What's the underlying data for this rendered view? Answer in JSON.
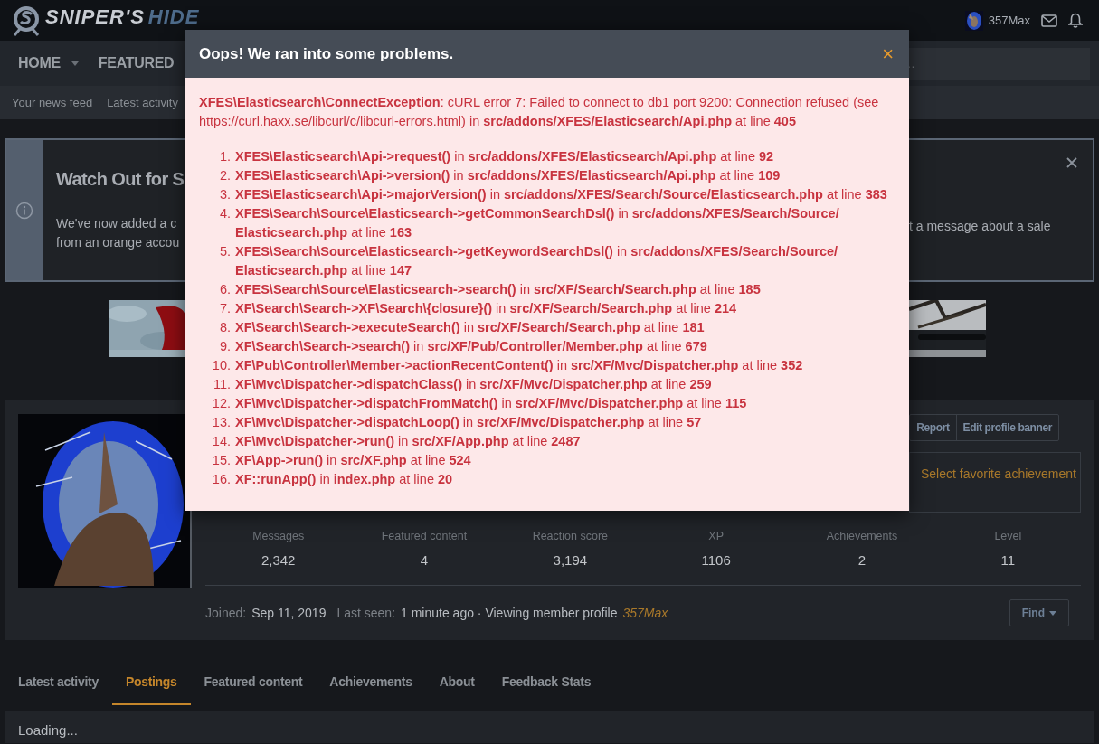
{
  "header": {
    "logo_primary": "SNIPER'S",
    "logo_secondary": "HIDE",
    "username": "357Max"
  },
  "nav": {
    "items": [
      {
        "label": "HOME",
        "dropdown": true
      },
      {
        "label": "FEATURED",
        "dropdown": false
      }
    ],
    "search": {
      "placeholder": "…"
    }
  },
  "subnav": [
    "Your news feed",
    "Latest activity"
  ],
  "notice": {
    "title": "Watch Out for S",
    "text_left": [
      "We've now added a c",
      "from an orange accou"
    ],
    "text_right": "t a message about a sale"
  },
  "profile": {
    "buttons": [
      "Report",
      "Edit profile banner"
    ],
    "favorite_achievement": "Select favorite achievement",
    "stats": [
      {
        "label": "Messages",
        "value": "2,342"
      },
      {
        "label": "Featured content",
        "value": "4"
      },
      {
        "label": "Reaction score",
        "value": "3,194"
      },
      {
        "label": "XP",
        "value": "1106"
      },
      {
        "label": "Achievements",
        "value": "2"
      },
      {
        "label": "Level",
        "value": "11"
      }
    ],
    "joined_label": "Joined:",
    "joined": "Sep 11, 2019",
    "last_seen_label": "Last seen:",
    "last_seen": "1 minute ago · Viewing member profile",
    "last_seen_name": "357Max",
    "find_button": "Find"
  },
  "tabs": [
    {
      "label": "Latest activity",
      "selected": false
    },
    {
      "label": "Postings",
      "selected": true
    },
    {
      "label": "Featured content",
      "selected": false
    },
    {
      "label": "Achievements",
      "selected": false
    },
    {
      "label": "About",
      "selected": false
    },
    {
      "label": "Feedback Stats",
      "selected": false
    }
  ],
  "loading": "Loading...",
  "dialog": {
    "title": "Oops! We ran into some problems.",
    "close": "×",
    "message": "**XFES\\Elasticsearch\\ConnectException**: cURL error 7: Failed to connect to db1 port 9200: Connection refused (see https://curl.haxx.se/libcurl/c/libcurl-errors.html) in **src/addons/XFES/Elasticsearch/Api.php** at line **405**",
    "trace": [
      {
        "num": "1.",
        "text": "**XFES\\Elasticsearch\\Api->request()** in **src/addons/XFES/Elasticsearch/Api.php** at line **92**"
      },
      {
        "num": "2.",
        "text": "**XFES\\Elasticsearch\\Api->version()** in **src/addons/XFES/Elasticsearch/Api.php** at line **109**"
      },
      {
        "num": "3.",
        "text": "**XFES\\Elasticsearch\\Api->majorVersion()** in **src/addons/XFES/Search/Source/Elasticsearch.php** at line **383**"
      },
      {
        "num": "4.",
        "text": "**XFES\\Search\\Source\\Elasticsearch->getCommonSearchDsl()** in **src/addons/XFES/Search/Source/ Elasticsearch.php** at line **163**"
      },
      {
        "num": "5.",
        "text": "**XFES\\Search\\Source\\Elasticsearch->getKeywordSearchDsl()** in **src/addons/XFES/Search/Source/ Elasticsearch.php** at line **147**"
      },
      {
        "num": "6.",
        "text": "**XFES\\Search\\Source\\Elasticsearch->search()** in **src/XF/Search/Search.php** at line **185**"
      },
      {
        "num": "7.",
        "text": "**XF\\Search\\Search->XF\\Search\\{closure}()** in **src/XF/Search/Search.php** at line **214**"
      },
      {
        "num": "8.",
        "text": "**XF\\Search\\Search->executeSearch()** in **src/XF/Search/Search.php** at line **181**"
      },
      {
        "num": "9.",
        "text": "**XF\\Search\\Search->search()** in **src/XF/Pub/Controller/Member.php** at line **679**"
      },
      {
        "num": "10.",
        "text": "**XF\\Pub\\Controller\\Member->actionRecentContent()** in **src/XF/Mvc/Dispatcher.php** at line **352**"
      },
      {
        "num": "11.",
        "text": "**XF\\Mvc\\Dispatcher->dispatchClass()** in **src/XF/Mvc/Dispatcher.php** at line **259**"
      },
      {
        "num": "12.",
        "text": "**XF\\Mvc\\Dispatcher->dispatchFromMatch()** in **src/XF/Mvc/Dispatcher.php** at line **115**"
      },
      {
        "num": "13.",
        "text": "**XF\\Mvc\\Dispatcher->dispatchLoop()** in **src/XF/Mvc/Dispatcher.php** at line **57**"
      },
      {
        "num": "14.",
        "text": "**XF\\Mvc\\Dispatcher->run()** in **src/XF/App.php** at line **2487**"
      },
      {
        "num": "15.",
        "text": "**XF\\App->run()** in **src/XF.php** at line **524**"
      },
      {
        "num": "16.",
        "text": "**XF::runApp()** in **index.php** at line **20**"
      }
    ]
  }
}
